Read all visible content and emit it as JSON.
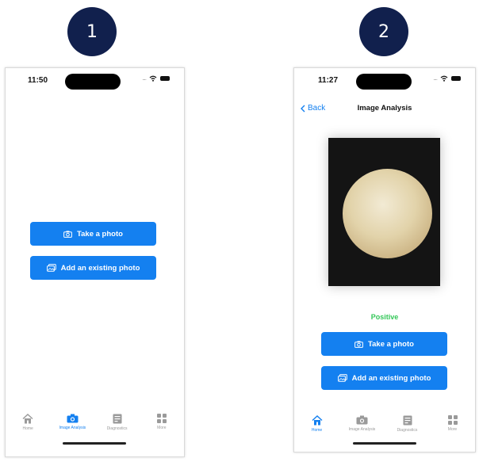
{
  "steps": [
    {
      "number": "1"
    },
    {
      "number": "2"
    }
  ],
  "screen1": {
    "status_time": "11:50",
    "take_photo_label": "Take a photo",
    "add_photo_label": "Add an existing photo",
    "tabs": [
      {
        "label": "Home",
        "icon": "home-icon"
      },
      {
        "label": "Image Analysis",
        "icon": "camera-icon",
        "active": true
      },
      {
        "label": "Diagnostics",
        "icon": "diagnostics-icon"
      },
      {
        "label": "More",
        "icon": "grid-icon"
      }
    ]
  },
  "screen2": {
    "status_time": "11:27",
    "back_label": "Back",
    "title": "Image Analysis",
    "result_label": "Positive",
    "take_photo_label": "Take a photo",
    "add_photo_label": "Add an existing photo",
    "tabs": [
      {
        "label": "Home",
        "icon": "home-icon",
        "active": true
      },
      {
        "label": "Image Analysis",
        "icon": "camera-icon"
      },
      {
        "label": "Diagnostics",
        "icon": "diagnostics-icon"
      },
      {
        "label": "More",
        "icon": "grid-icon"
      }
    ]
  },
  "colors": {
    "accent": "#1480f0",
    "badge": "#11204d",
    "positive": "#34c759"
  }
}
